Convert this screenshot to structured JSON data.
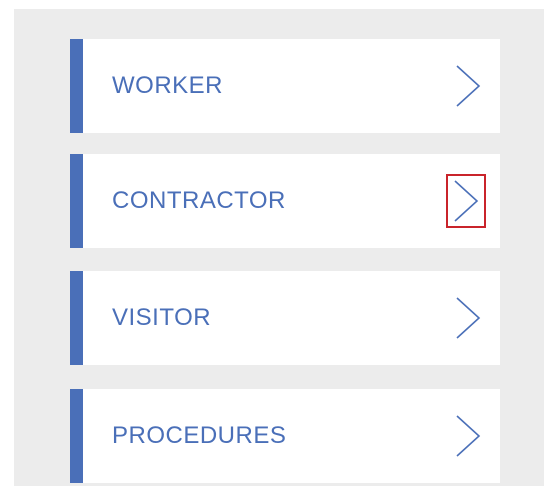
{
  "menu": {
    "items": [
      {
        "label": "WORKER",
        "icon": "chevron-right-icon",
        "highlighted": false
      },
      {
        "label": "CONTRACTOR",
        "icon": "chevron-right-icon",
        "highlighted": true
      },
      {
        "label": "VISITOR",
        "icon": "chevron-right-icon",
        "highlighted": false
      },
      {
        "label": "PROCEDURES",
        "icon": "chevron-right-icon",
        "highlighted": false
      }
    ]
  },
  "colors": {
    "accent": "#4a6fb8",
    "panel_background": "#ececec",
    "highlight_border": "#c9242b"
  }
}
